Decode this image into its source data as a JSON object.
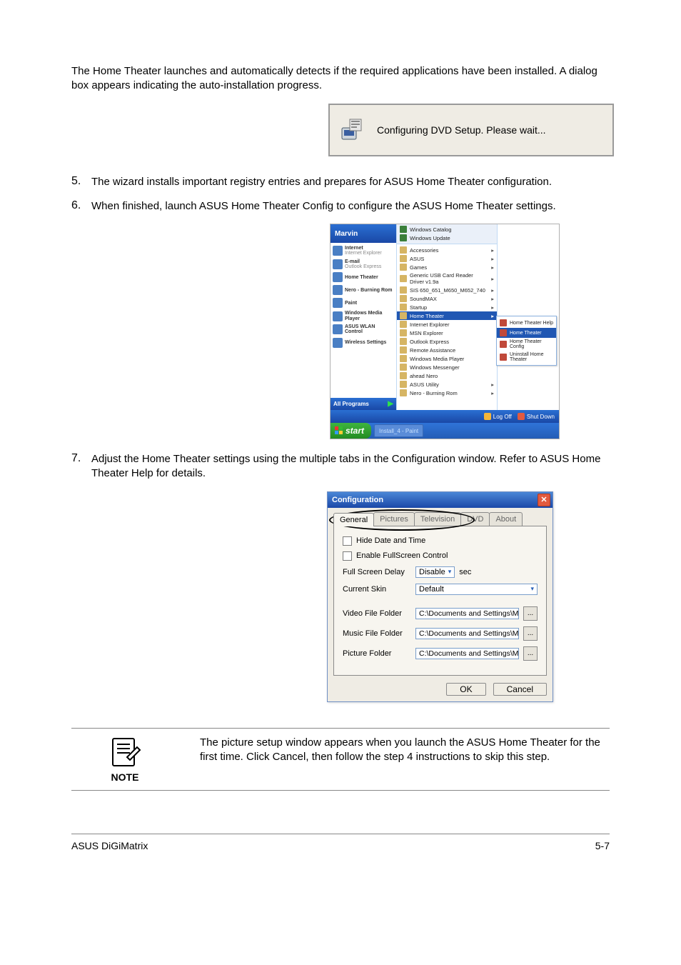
{
  "para_intro": "The Home Theater launches and automatically detects if the required applications have been installed. A dialog box appears indicating the auto-installation progress.",
  "step5_num": "5.",
  "step5_text": "The wizard installs important registry entries and prepares for ASUS Home Theater configuration.",
  "step6_num": "6.",
  "step6_text": "When finished, launch ASUS Home Theater Config to configure the ASUS Home Theater settings.",
  "step7_num": "7.",
  "step7_text": "Adjust the Home Theater settings using the multiple tabs in the Configuration window. Refer to ASUS Home Theater Help for details.",
  "dlg_wait_text": "Configuring DVD Setup. Please wait...",
  "startmenu": {
    "user": "Marvin",
    "pinned": [
      {
        "t": "Internet",
        "s": "Internet Explorer"
      },
      {
        "t": "E-mail",
        "s": "Outlook Express"
      },
      {
        "t": "Home Theater",
        "s": ""
      },
      {
        "t": "Nero - Burning Rom",
        "s": ""
      },
      {
        "t": "Paint",
        "s": ""
      },
      {
        "t": "Windows Media Player",
        "s": ""
      },
      {
        "t": "ASUS WLAN Control",
        "s": ""
      },
      {
        "t": "Wireless Settings",
        "s": ""
      }
    ],
    "allprograms": "All Programs",
    "top": [
      "Windows Catalog",
      "Windows Update"
    ],
    "mid": [
      "Accessories",
      "ASUS",
      "Games",
      "Generic USB Card Reader Driver v1.9a",
      "SIS 650_651_M650_M652_740",
      "SoundMAX",
      "Startup"
    ],
    "highlight": "Home Theater",
    "mid2": [
      "Internet Explorer",
      "MSN Explorer",
      "Outlook Express",
      "Remote Assistance",
      "Windows Media Player",
      "Windows Messenger",
      "ahead Nero",
      "ASUS Utility",
      "Nero - Burning Rom"
    ],
    "flyout": [
      {
        "t": "Home Theater Help",
        "hl": false
      },
      {
        "t": "Home Theater",
        "hl": true
      },
      {
        "t": "Home Theater Config",
        "hl": false
      },
      {
        "t": "Uninstall Home Theater",
        "hl": false
      }
    ],
    "logoff": "Log Off",
    "shutdown": "Shut Down",
    "start": "start",
    "task": "Install_4 - Paint"
  },
  "cfg": {
    "title": "Configuration",
    "tabs": [
      "General",
      "Pictures",
      "Television",
      "DVD",
      "About"
    ],
    "active_tab": 0,
    "hide_date": "Hide Date and Time",
    "enable_fs": "Enable FullScreen Control",
    "fsd_label": "Full Screen Delay",
    "fsd_value": "Disable",
    "fsd_unit": "sec",
    "skin_label": "Current Skin",
    "skin_value": "Default",
    "vff_label": "Video File Folder",
    "mff_label": "Music File Folder",
    "pf_label": "Picture Folder",
    "path_value": "C:\\Documents and Settings\\Macmac\\M",
    "browse": "...",
    "ok": "OK",
    "cancel": "Cancel"
  },
  "note_label": "NOTE",
  "note_text": "The picture setup window appears when you launch the ASUS Home Theater for the first time. Click Cancel, then follow the step 4 instructions to skip this step.",
  "footer_left": "ASUS DiGiMatrix",
  "footer_right": "5-7"
}
